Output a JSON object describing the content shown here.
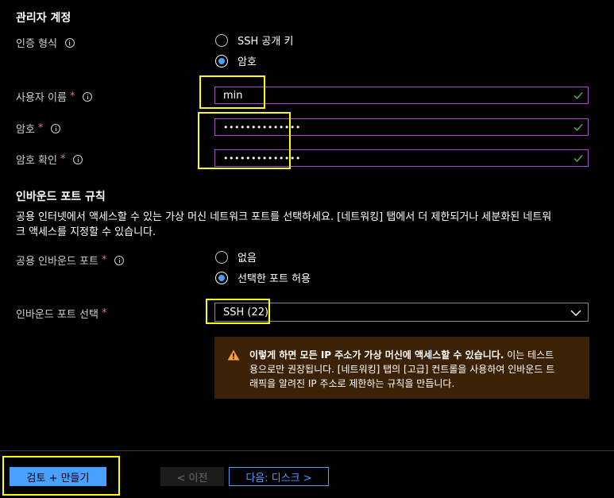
{
  "admin": {
    "title": "관리자 계정",
    "auth_type_label": "인증 형식",
    "auth_options": [
      {
        "label": "SSH 공개 키",
        "checked": false
      },
      {
        "label": "암호",
        "checked": true
      }
    ],
    "username_label": "사용자 이름",
    "username_value": "min",
    "password_label": "암호",
    "password_value": "••••••••••••••",
    "confirm_label": "암호 확인",
    "confirm_value": "••••••••••••••",
    "required_mark": "*"
  },
  "inbound": {
    "title": "인바운드 포트 규칙",
    "description_line1": "공용 인터넷에서 액세스할 수 있는 가상 머신 네트워크 포트를 선택하세요. [네트워킹] 탭에서 더 제한되거나 세분화된 네트워",
    "description_line2": "크 액세스를 지정할 수 있습니다.",
    "public_ports_label": "공용 인바운드 포트",
    "public_options": [
      {
        "label": "없음",
        "checked": false
      },
      {
        "label": "선택한 포트 허용",
        "checked": true
      }
    ],
    "select_ports_label": "인바운드 포트 선택",
    "select_ports_value": "SSH (22)",
    "warning_bold": "이렇게 하면 모든 IP 주소가 가상 머신에 액세스할 수 있습니다.",
    "warning_rest1": " 이는 테스트",
    "warning_line2": "용으로만 권장됩니다. [네트워킹] 탭의 [고급] 컨트롤을 사용하여 인바운드 트",
    "warning_line3": "래픽을 알려진 IP 주소로 제한하는 규칙을 만듭니다."
  },
  "footer": {
    "review_create": "검토 + 만들기",
    "previous": "< 이전",
    "next": "다음: 디스크 >"
  },
  "colors": {
    "accent": "#4aa0ff",
    "required": "#f1707b",
    "valid_check": "#57a64a",
    "field_border": "#a64dbf",
    "highlight": "#ffff00",
    "warning_bg": "#3b2106",
    "warning_icon": "#fca130"
  },
  "icons": [
    "info-icon",
    "check-icon",
    "chevron-down-icon",
    "warning-icon"
  ]
}
